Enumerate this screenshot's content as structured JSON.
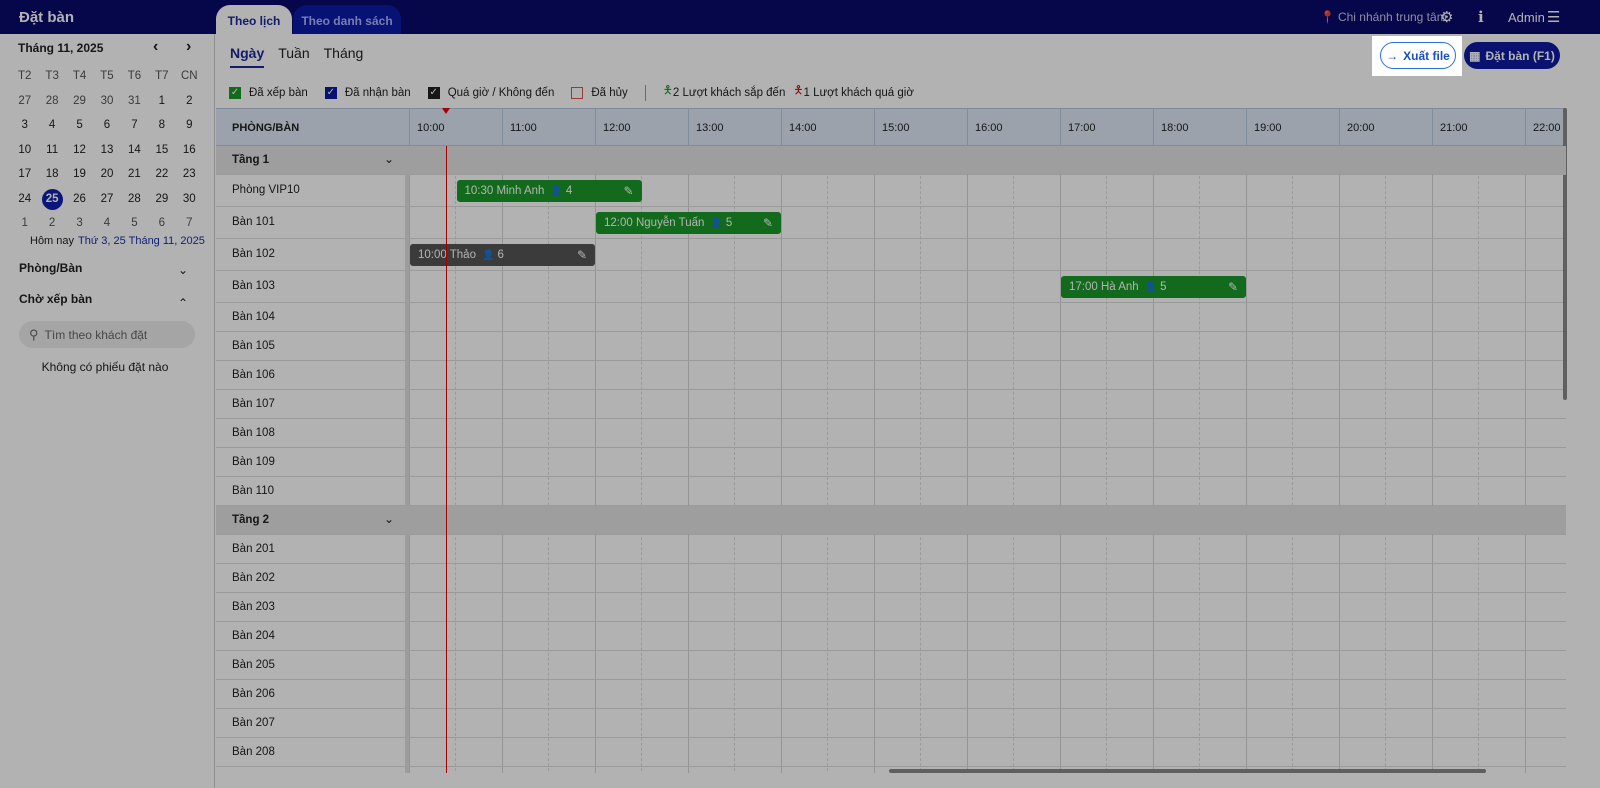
{
  "header": {
    "title": "Đặt bàn",
    "tabs": [
      {
        "label": "Theo lịch"
      },
      {
        "label": "Theo danh sách"
      }
    ],
    "branch": "Chi nhánh trung tâm",
    "user": "Admin"
  },
  "calendar": {
    "month_label": "Tháng 11, 2025",
    "weekdays": [
      "T2",
      "T3",
      "T4",
      "T5",
      "T6",
      "T7",
      "CN"
    ],
    "days": [
      "27",
      "28",
      "29",
      "30",
      "31",
      "1",
      "2",
      "3",
      "4",
      "5",
      "6",
      "7",
      "8",
      "9",
      "10",
      "11",
      "12",
      "13",
      "14",
      "15",
      "16",
      "17",
      "18",
      "19",
      "20",
      "21",
      "22",
      "23",
      "24",
      "25",
      "26",
      "27",
      "28",
      "29",
      "30",
      "1",
      "2",
      "3",
      "4",
      "5",
      "6",
      "7"
    ],
    "selected": "25",
    "today_label": "Hôm nay",
    "today_value": "Thứ 3, 25 Tháng 11, 2025"
  },
  "sidebar": {
    "rooms_label": "Phòng/Bàn",
    "waiting_label": "Chờ xếp bàn",
    "search_placeholder": "Tìm theo khách đặt",
    "empty": "Không có phiếu đặt nào"
  },
  "views": [
    {
      "label": "Ngày"
    },
    {
      "label": "Tuần"
    },
    {
      "label": "Tháng"
    }
  ],
  "legend": {
    "items": [
      {
        "label": "Đã xếp bàn",
        "color": "#1a9a2a"
      },
      {
        "label": "Đã nhận bàn",
        "color": "#0d1aa0"
      },
      {
        "label": "Quá giờ / Không đến",
        "color": "#222222"
      },
      {
        "label": "Đã hủy",
        "color": "#e05050"
      }
    ],
    "upcoming": "2 Lượt khách sắp đến",
    "overdue": "1 Lượt khách quá giờ"
  },
  "actions": {
    "export": "Xuất file",
    "book": "Đặt bàn (F1)"
  },
  "grid": {
    "room_header": "PHÒNG/BÀN",
    "hours": [
      "10:00",
      "11:00",
      "12:00",
      "13:00",
      "14:00",
      "15:00",
      "16:00",
      "17:00",
      "18:00",
      "19:00",
      "20:00",
      "21:00",
      "22:00"
    ],
    "now": "10:24",
    "rows": [
      {
        "name": "Tầng 1",
        "floor": true
      },
      {
        "name": "Phòng VIP10",
        "bookings": [
          {
            "label": "10:30 Minh Anh",
            "guests": "4",
            "start": 10.5,
            "end": 12.5,
            "status": "Đã xếp bàn"
          }
        ]
      },
      {
        "name": "Bàn 101",
        "bookings": [
          {
            "label": "12:00 Nguyễn Tuấn",
            "guests": "5",
            "start": 12,
            "end": 14,
            "status": "Đã xếp bàn"
          }
        ]
      },
      {
        "name": "Bàn 102",
        "bookings": [
          {
            "label": "10:00 Thảo",
            "guests": "6",
            "start": 10,
            "end": 12,
            "status": "Quá giờ / Không đến"
          }
        ]
      },
      {
        "name": "Bàn 103",
        "bookings": [
          {
            "label": "17:00 Hà Anh",
            "guests": "5",
            "start": 17,
            "end": 19,
            "status": "Đã xếp bàn"
          }
        ]
      },
      {
        "name": "Bàn 104"
      },
      {
        "name": "Bàn 105"
      },
      {
        "name": "Bàn 106"
      },
      {
        "name": "Bàn 107"
      },
      {
        "name": "Bàn 108"
      },
      {
        "name": "Bàn 109"
      },
      {
        "name": "Bàn 110"
      },
      {
        "name": "Tầng 2",
        "floor": true
      },
      {
        "name": "Bàn 201"
      },
      {
        "name": "Bàn 202"
      },
      {
        "name": "Bàn 203"
      },
      {
        "name": "Bàn 204"
      },
      {
        "name": "Bàn 205"
      },
      {
        "name": "Bàn 206"
      },
      {
        "name": "Bàn 207"
      },
      {
        "name": "Bàn 208"
      }
    ]
  }
}
